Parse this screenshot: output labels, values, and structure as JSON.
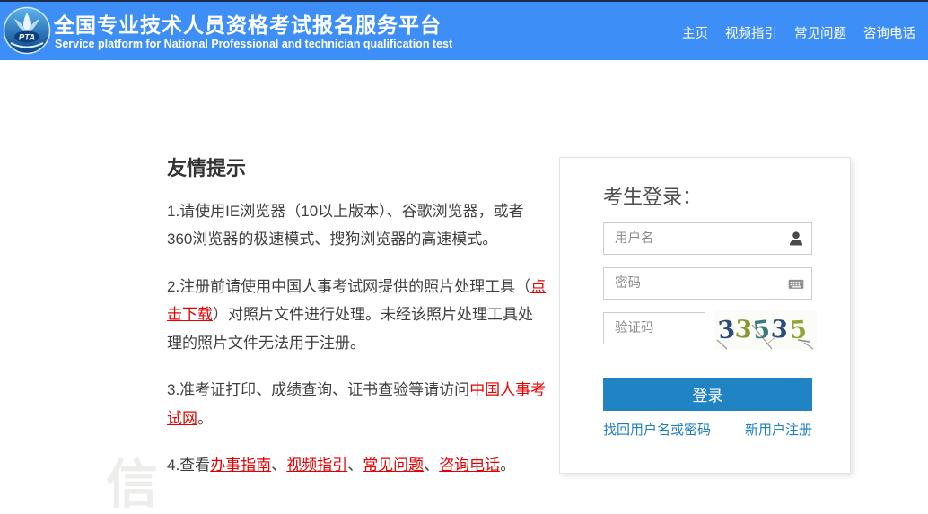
{
  "colors": {
    "header_bg": "#3E8EF7",
    "header_topline": "#1C2B4A",
    "accent_red": "#E60000",
    "button_blue": "#1F83C4",
    "link_blue": "#1E7EC8"
  },
  "header": {
    "logo_text": "PTA",
    "title": "全国专业技术人员资格考试报名服务平台",
    "subtitle": "Service platform for National Professional and technician qualification test",
    "nav": [
      {
        "label": "主页"
      },
      {
        "label": "视频指引"
      },
      {
        "label": "常见问题"
      },
      {
        "label": "咨询电话"
      }
    ]
  },
  "tips": {
    "heading": "友情提示",
    "item1": {
      "text": "1.请使用IE浏览器（10以上版本）、谷歌浏览器，或者360浏览器的极速模式、搜狗浏览器的高速模式。"
    },
    "item2": {
      "before": "2.注册前请使用中国人事考试网提供的照片处理工具（",
      "link": "点击下载",
      "after": "）对照片文件进行处理。未经该照片处理工具处理的照片文件无法用于注册。"
    },
    "item3": {
      "before": "3.准考证打印、成绩查询、证书查验等请访问",
      "link": "中国人事考试网",
      "after": "。"
    },
    "item4": {
      "before": "4.查看",
      "links": [
        "办事指南",
        "视频指引",
        "常见问题",
        "咨询电话"
      ],
      "sep": "、",
      "after": "。"
    }
  },
  "login": {
    "title": "考生登录：",
    "username_placeholder": "用户名",
    "password_placeholder": "密码",
    "captcha_placeholder": "验证码",
    "captcha": {
      "text": "33535",
      "digits": [
        {
          "char": "3",
          "color": "#2D4A7E"
        },
        {
          "char": "3",
          "color": "#8A9638"
        },
        {
          "char": "5",
          "color": "#3D7A80"
        },
        {
          "char": "3",
          "color": "#2D4A7E"
        },
        {
          "char": "5",
          "color": "#95A332"
        }
      ]
    },
    "login_button": "登录",
    "forgot_link": "找回用户名或密码",
    "register_link": "新用户注册"
  },
  "watermark_glyph": "信"
}
